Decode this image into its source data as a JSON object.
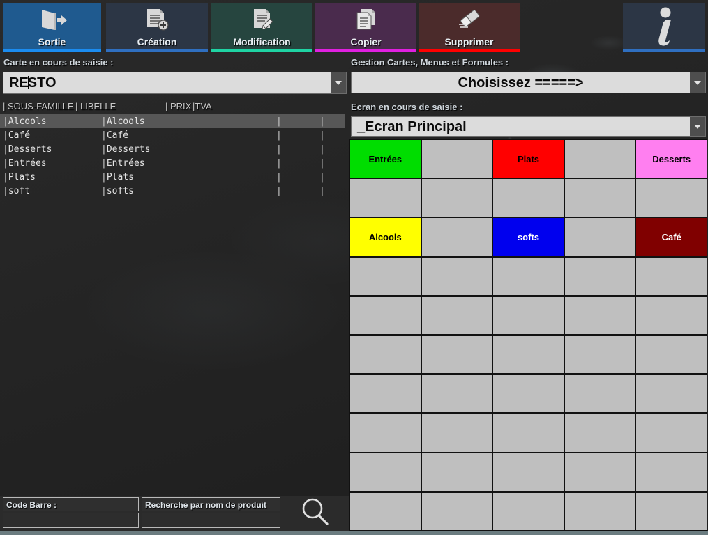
{
  "toolbar": {
    "buttons": [
      {
        "label": "Sortie",
        "icon": "exit-door-icon",
        "bg": "#1f5a8f",
        "underline": "#1b8cf0"
      },
      {
        "label": "Création",
        "icon": "document-add-icon",
        "bg": "#2c3645",
        "underline": "#2f6fc0"
      },
      {
        "label": "Modification",
        "icon": "document-edit-icon",
        "bg": "#26453f",
        "underline": "#1fd3a3"
      },
      {
        "label": "Copier",
        "icon": "document-copy-icon",
        "bg": "#4a2b4d",
        "underline": "#e020e0"
      },
      {
        "label": "Supprimer",
        "icon": "eraser-icon",
        "bg": "#4b2b2b",
        "underline": "#ff0000"
      }
    ],
    "info_button": {
      "label": "i",
      "icon": "info-icon",
      "bg": "#2c3645",
      "underline": "#2f6fc0"
    }
  },
  "left_panel": {
    "carte_label": "Carte en cours de saisie :",
    "carte_value": "RESTO",
    "carte_value_before_caret": "RE",
    "carte_value_after_caret": "STO",
    "columns": {
      "sous_famille": "| SOUS-FAMILLE",
      "libelle": "| LIBELLE",
      "prix": "| PRIX",
      "tva": "|TVA"
    },
    "rows": [
      {
        "sous_famille": "Alcools",
        "libelle": "Alcools",
        "prix": "",
        "tva": "",
        "selected": true
      },
      {
        "sous_famille": "Café",
        "libelle": "Café",
        "prix": "",
        "tva": "",
        "selected": false
      },
      {
        "sous_famille": "Desserts",
        "libelle": "Desserts",
        "prix": "",
        "tva": "",
        "selected": false
      },
      {
        "sous_famille": "Entrées",
        "libelle": "Entrées",
        "prix": "",
        "tva": "",
        "selected": false
      },
      {
        "sous_famille": "Plats",
        "libelle": "Plats",
        "prix": "",
        "tva": "",
        "selected": false
      },
      {
        "sous_famille": "soft",
        "libelle": "softs",
        "prix": "",
        "tva": "",
        "selected": false
      }
    ]
  },
  "search": {
    "barcode_label": "Code Barre :",
    "barcode_value": "",
    "barcode_placeholder": "",
    "product_label": "Recherche par nom de produit",
    "product_value": "",
    "product_placeholder": "",
    "search_icon": "magnifier-icon"
  },
  "right_panel": {
    "gestion_label": "Gestion Cartes, Menus et Formules  :",
    "gestion_value": "Choisissez  =====>",
    "ecran_label": "Ecran en cours de saisie :",
    "ecran_value": "_Ecran Principal"
  },
  "keypad": {
    "rows": 10,
    "cols": 5,
    "default_bg": "#bfbfbf",
    "cells": [
      {
        "r": 0,
        "c": 0,
        "label": "Entrées",
        "bg": "#00dd00",
        "fg": "#000000"
      },
      {
        "r": 0,
        "c": 2,
        "label": "Plats",
        "bg": "#ff0000",
        "fg": "#000000"
      },
      {
        "r": 0,
        "c": 4,
        "label": "Desserts",
        "bg": "#ff7ff0",
        "fg": "#000000"
      },
      {
        "r": 2,
        "c": 0,
        "label": "Alcools",
        "bg": "#ffff00",
        "fg": "#000000"
      },
      {
        "r": 2,
        "c": 2,
        "label": "softs",
        "bg": "#0000ee",
        "fg": "#ffffff"
      },
      {
        "r": 2,
        "c": 4,
        "label": "Café",
        "bg": "#800000",
        "fg": "#ffffff"
      }
    ]
  }
}
